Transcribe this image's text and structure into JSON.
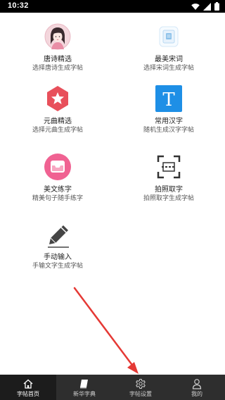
{
  "status_bar": {
    "time": "10:32",
    "icons": [
      "wifi-icon",
      "signal-icon",
      "battery-icon"
    ]
  },
  "tiles": [
    {
      "title": "唐诗精选",
      "subtitle": "选择唐诗生成字帖",
      "icon": "portrait-icon"
    },
    {
      "title": "最美宋词",
      "subtitle": "选择宋词生成字帖",
      "icon": "scroll-icon"
    },
    {
      "title": "元曲精选",
      "subtitle": "选择元曲生成字帖",
      "icon": "star-icon"
    },
    {
      "title": "常用汉字",
      "subtitle": "随机生成汉字字帖",
      "icon": "letter-t-icon"
    },
    {
      "title": "美文练字",
      "subtitle": "精美句子随手练字",
      "icon": "inbox-icon"
    },
    {
      "title": "拍照取字",
      "subtitle": "拍照取字生成字帖",
      "icon": "scan-icon"
    },
    {
      "title": "手动输入",
      "subtitle": "手输文字生成字帖",
      "icon": "pencil-icon"
    }
  ],
  "nav": {
    "items": [
      {
        "label": "字帖首页",
        "icon": "home-icon",
        "active": true
      },
      {
        "label": "新华字典",
        "icon": "book-icon",
        "active": false
      },
      {
        "label": "字帖设置",
        "icon": "gear-icon",
        "active": false
      },
      {
        "label": "我的",
        "icon": "person-icon",
        "active": false
      }
    ]
  },
  "colors": {
    "status_bar": "#000000",
    "nav_bar": "#2e2e2e",
    "star_icon": "#e8505b",
    "letter_t_icon": "#1e8fe6",
    "inbox_icon": "#f06292",
    "pencil_icon": "#454545",
    "annotation_arrow": "#e53935"
  }
}
